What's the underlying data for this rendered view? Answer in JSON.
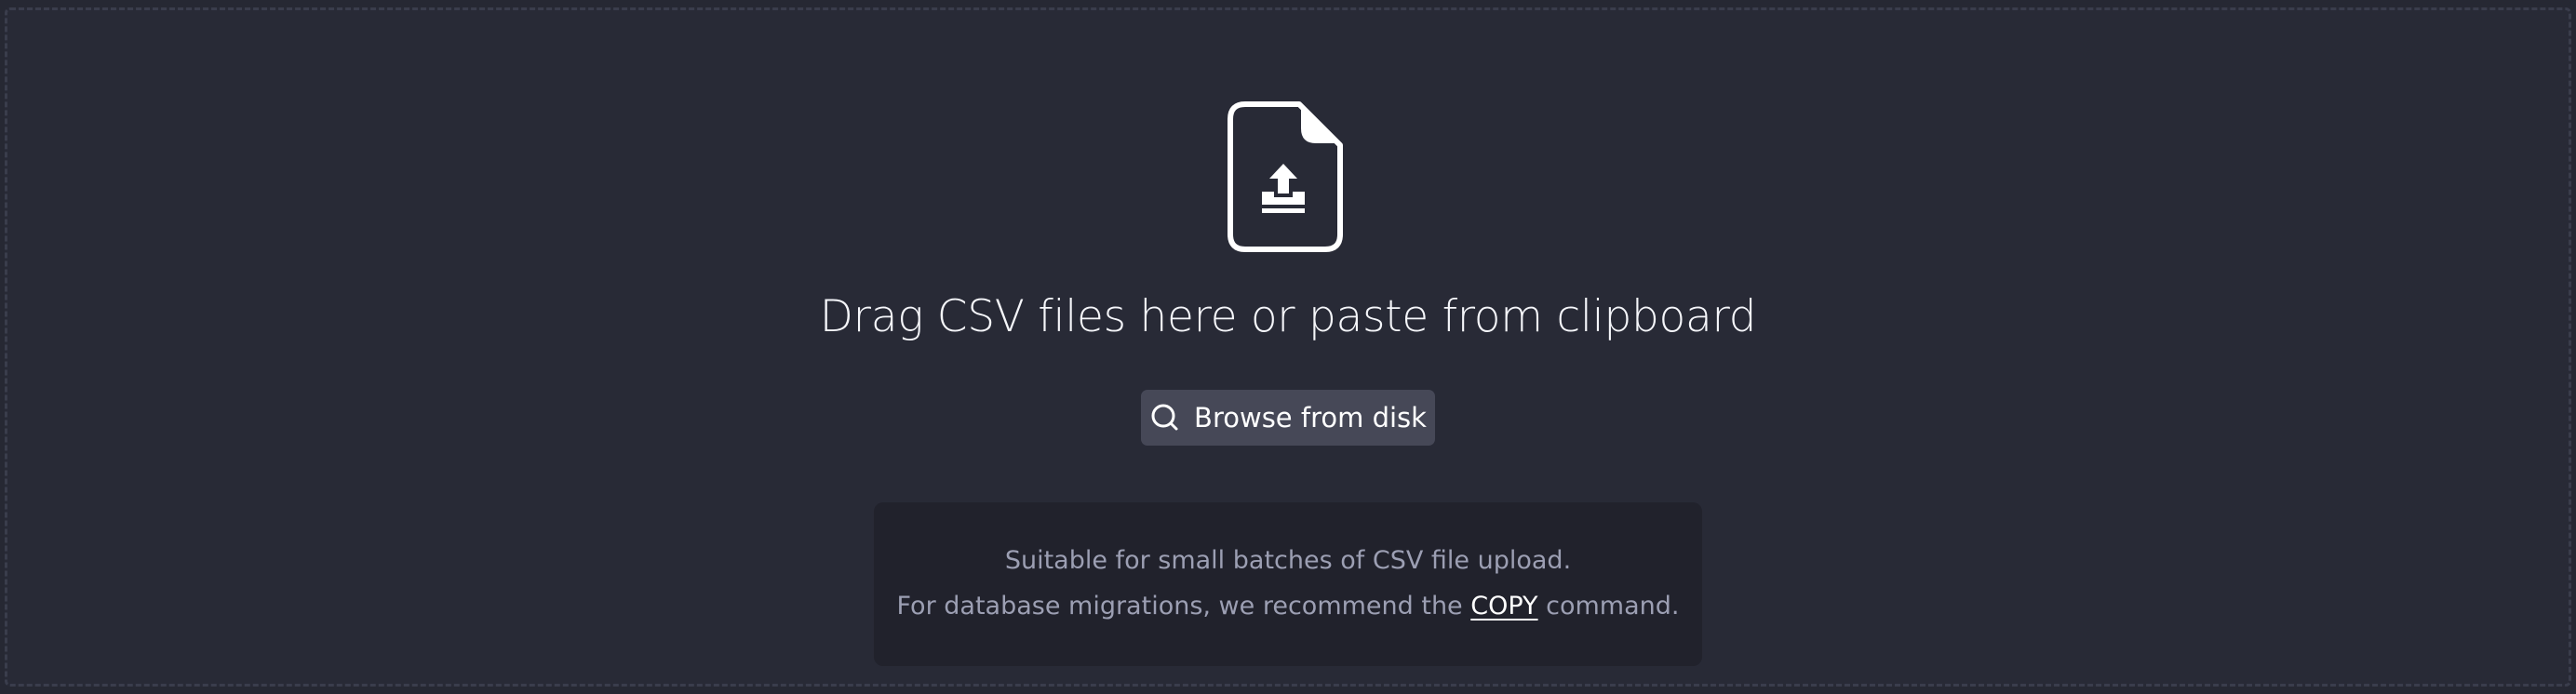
{
  "dropzone": {
    "icon": "file-upload-icon",
    "headline": "Drag CSV files here or paste from clipboard",
    "browse_button": {
      "icon": "search-icon",
      "label": "Browse from disk"
    },
    "info": {
      "line1": "Suitable for small batches of CSV file upload.",
      "line2_prefix": "For database migrations, we recommend the ",
      "copy_link_label": "COPY",
      "line2_suffix": " command."
    }
  },
  "colors": {
    "background": "#282a36",
    "button": "#464857",
    "info_box": "#21222c",
    "muted_text": "#9c9fb3",
    "text": "#f5f6fa"
  }
}
